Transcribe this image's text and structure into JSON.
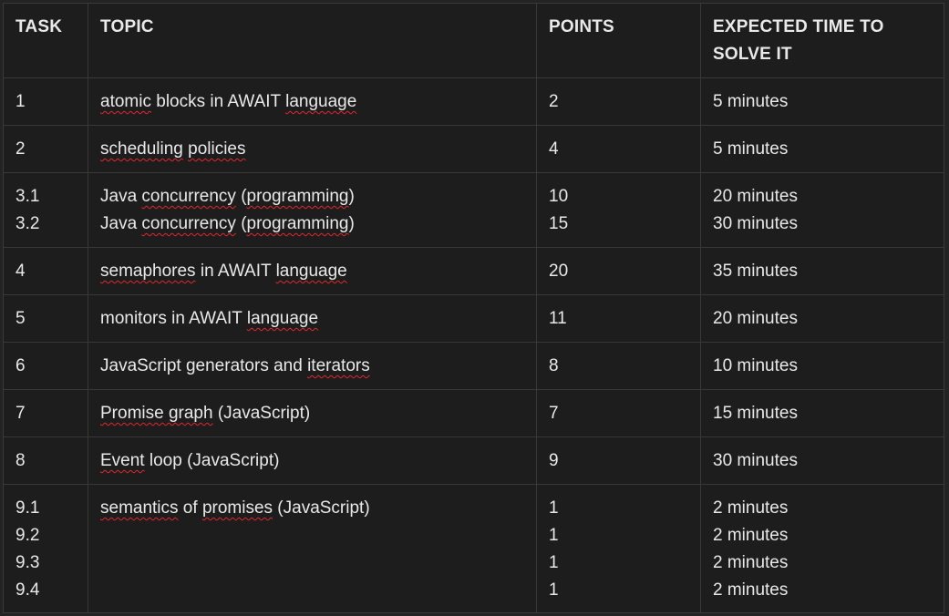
{
  "table": {
    "headers": [
      "TASK",
      "TOPIC",
      "POINTS",
      "EXPECTED TIME TO SOLVE IT"
    ],
    "rows": [
      {
        "task": [
          "1"
        ],
        "topic": [
          [
            {
              "t": "atomic",
              "s": true
            },
            {
              "t": " blocks in AWAIT ",
              "s": false
            },
            {
              "t": "language",
              "s": true
            }
          ]
        ],
        "points": [
          "2"
        ],
        "time": [
          "5 minutes"
        ]
      },
      {
        "task": [
          "2"
        ],
        "topic": [
          [
            {
              "t": "scheduling",
              "s": true
            },
            {
              "t": " ",
              "s": false
            },
            {
              "t": "policies",
              "s": true
            }
          ]
        ],
        "points": [
          "4"
        ],
        "time": [
          "5 minutes"
        ]
      },
      {
        "task": [
          "3.1",
          "3.2"
        ],
        "topic": [
          [
            {
              "t": "Java ",
              "s": false
            },
            {
              "t": "concurrency",
              "s": true
            },
            {
              "t": " (",
              "s": false
            },
            {
              "t": "programming",
              "s": true
            },
            {
              "t": ")",
              "s": false
            }
          ],
          [
            {
              "t": "Java ",
              "s": false
            },
            {
              "t": "concurrency",
              "s": true
            },
            {
              "t": " (",
              "s": false
            },
            {
              "t": "programming",
              "s": true
            },
            {
              "t": ")",
              "s": false
            }
          ]
        ],
        "points": [
          "10",
          "15"
        ],
        "time": [
          "20 minutes",
          "30 minutes"
        ]
      },
      {
        "task": [
          "4"
        ],
        "topic": [
          [
            {
              "t": "semaphores",
              "s": true
            },
            {
              "t": " in AWAIT ",
              "s": false
            },
            {
              "t": "language",
              "s": true
            }
          ]
        ],
        "points": [
          "20"
        ],
        "time": [
          "35 minutes"
        ]
      },
      {
        "task": [
          "5"
        ],
        "topic": [
          [
            {
              "t": "monitors in AWAIT ",
              "s": false
            },
            {
              "t": "language",
              "s": true
            }
          ]
        ],
        "points": [
          "11"
        ],
        "time": [
          "20 minutes"
        ]
      },
      {
        "task": [
          "6"
        ],
        "topic": [
          [
            {
              "t": "JavaScript generators and ",
              "s": false
            },
            {
              "t": "iterators",
              "s": true
            }
          ]
        ],
        "points": [
          "8"
        ],
        "time": [
          "10 minutes"
        ]
      },
      {
        "task": [
          "7"
        ],
        "topic": [
          [
            {
              "t": "Promise graph",
              "s": true
            },
            {
              "t": " (JavaScript)",
              "s": false
            }
          ]
        ],
        "points": [
          "7"
        ],
        "time": [
          "15 minutes"
        ]
      },
      {
        "task": [
          "8"
        ],
        "topic": [
          [
            {
              "t": "Event",
              "s": true
            },
            {
              "t": " loop (JavaScript)",
              "s": false
            }
          ]
        ],
        "points": [
          "9"
        ],
        "time": [
          "30 minutes"
        ]
      },
      {
        "task": [
          "9.1",
          "9.2",
          "9.3",
          "9.4"
        ],
        "topic": [
          [
            {
              "t": "semantics",
              "s": true
            },
            {
              "t": " of ",
              "s": false
            },
            {
              "t": "promises",
              "s": true
            },
            {
              "t": " (JavaScript)",
              "s": false
            }
          ]
        ],
        "points": [
          "1",
          "1",
          "1",
          "1"
        ],
        "time": [
          "2 minutes",
          "2 minutes",
          "2 minutes",
          "2 minutes"
        ]
      }
    ]
  }
}
